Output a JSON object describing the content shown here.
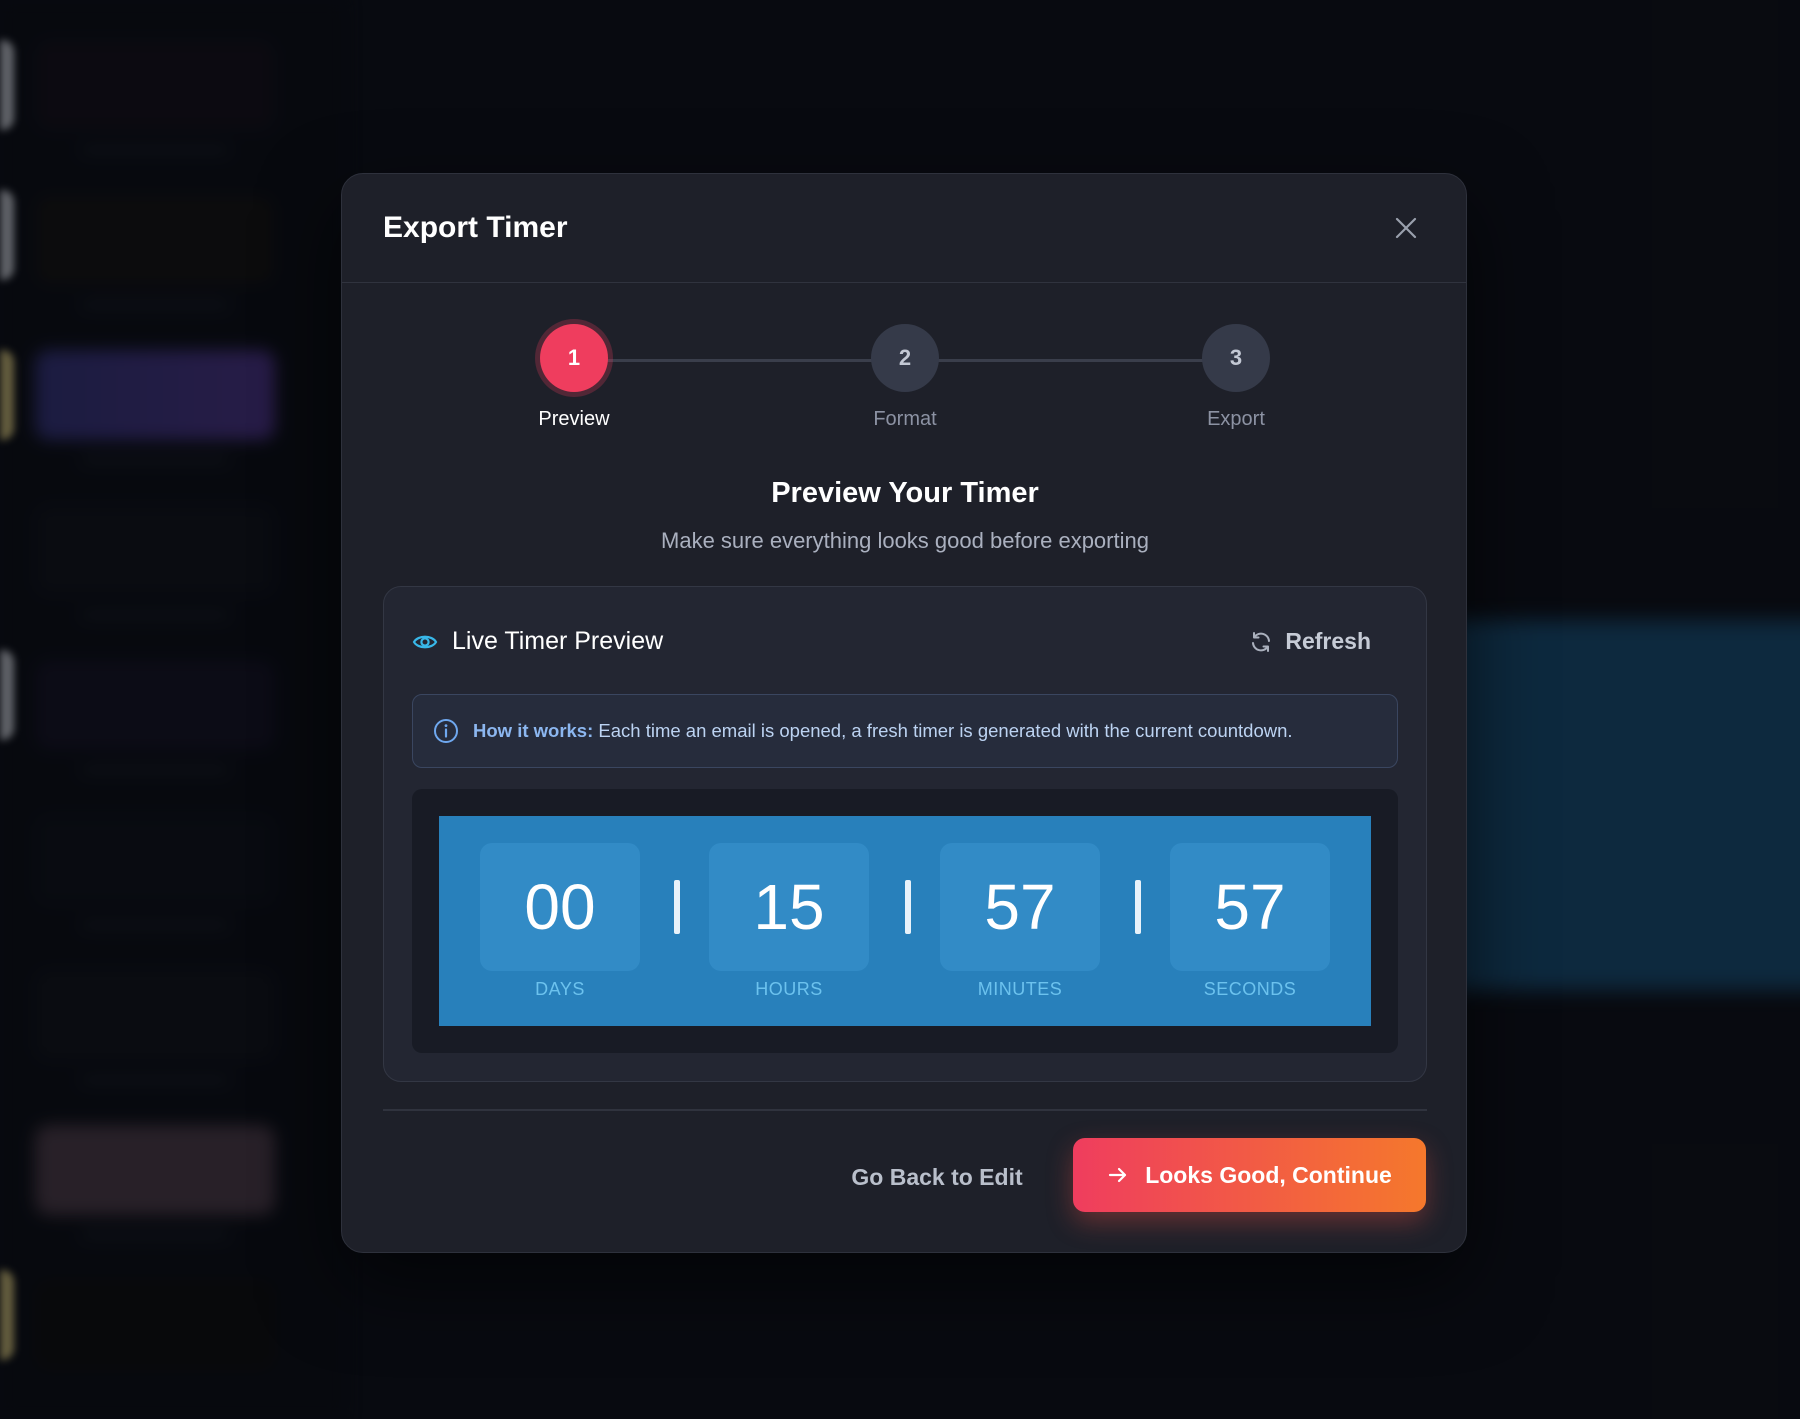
{
  "modal": {
    "title": "Export Timer",
    "close_icon": "close-icon"
  },
  "stepper": {
    "steps": [
      {
        "number": "1",
        "label": "Preview",
        "state": "active"
      },
      {
        "number": "2",
        "label": "Format",
        "state": "upcoming"
      },
      {
        "number": "3",
        "label": "Export",
        "state": "upcoming"
      }
    ]
  },
  "section": {
    "title": "Preview Your Timer",
    "subtitle": "Make sure everything looks good before exporting"
  },
  "preview": {
    "title": "Live Timer Preview",
    "title_icon": "eye-icon",
    "refresh_label": "Refresh",
    "refresh_icon": "refresh-icon",
    "info_icon": "info-icon",
    "info_label": "How it works:",
    "info_text": " Each time an email is opened, a fresh timer is generated with the current countdown.",
    "timer": {
      "units": [
        {
          "value": "00",
          "label": "DAYS"
        },
        {
          "value": "15",
          "label": "HOURS"
        },
        {
          "value": "57",
          "label": "MINUTES"
        },
        {
          "value": "57",
          "label": "SECONDS"
        }
      ]
    }
  },
  "footer": {
    "back_label": "Go Back to Edit",
    "continue_label": "Looks Good, Continue",
    "continue_icon": "arrow-right-icon"
  },
  "colors": {
    "accent_start": "#ef3d5e",
    "accent_end": "#f5782c",
    "timer_bg": "#2880bb",
    "modal_bg": "#1e2029"
  }
}
